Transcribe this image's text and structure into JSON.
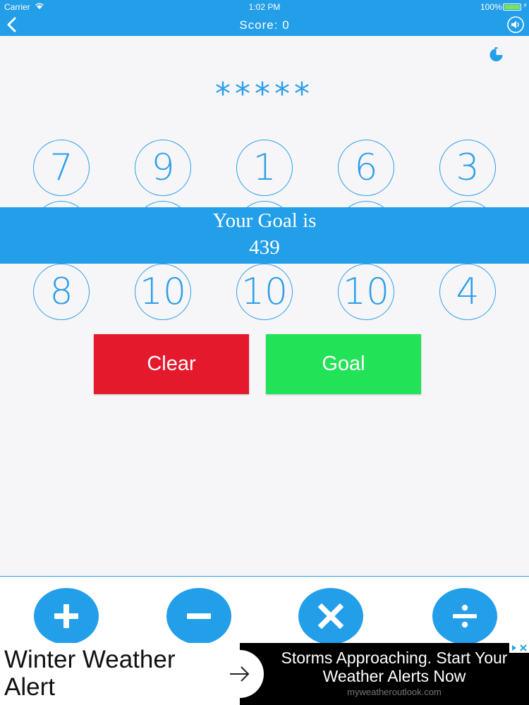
{
  "status_bar": {
    "carrier": "Carrier",
    "time": "1:02 PM",
    "battery": "100%"
  },
  "nav": {
    "score_label": "Score:",
    "score_value": "0",
    "score_text": "Score:  0"
  },
  "hidden_answer": "*****",
  "numbers": {
    "row1": [
      "7",
      "9",
      "1",
      "6",
      "3"
    ],
    "row3": [
      "8",
      "10",
      "10",
      "10",
      "4"
    ]
  },
  "goal": {
    "label": "Your Goal is",
    "value": "439"
  },
  "buttons": {
    "clear": "Clear",
    "goal": "Goal"
  },
  "operators": [
    "plus",
    "minus",
    "times",
    "divide"
  ],
  "ad": {
    "headline": "Winter Weather Alert",
    "body": "Storms Approaching. Start Your Weather Alerts Now",
    "domain": "myweatheroutlook.com"
  },
  "colors": {
    "primary_blue": "#239ee8",
    "clear_red": "#e4192c",
    "goal_green": "#22e258",
    "background": "#f6f6f8"
  },
  "icons": {
    "back": "chevron-left-icon",
    "sound": "speaker-icon",
    "timer": "timer-icon",
    "ad_arrow": "arrow-right-icon",
    "ad_choices": "adchoices-icon"
  }
}
